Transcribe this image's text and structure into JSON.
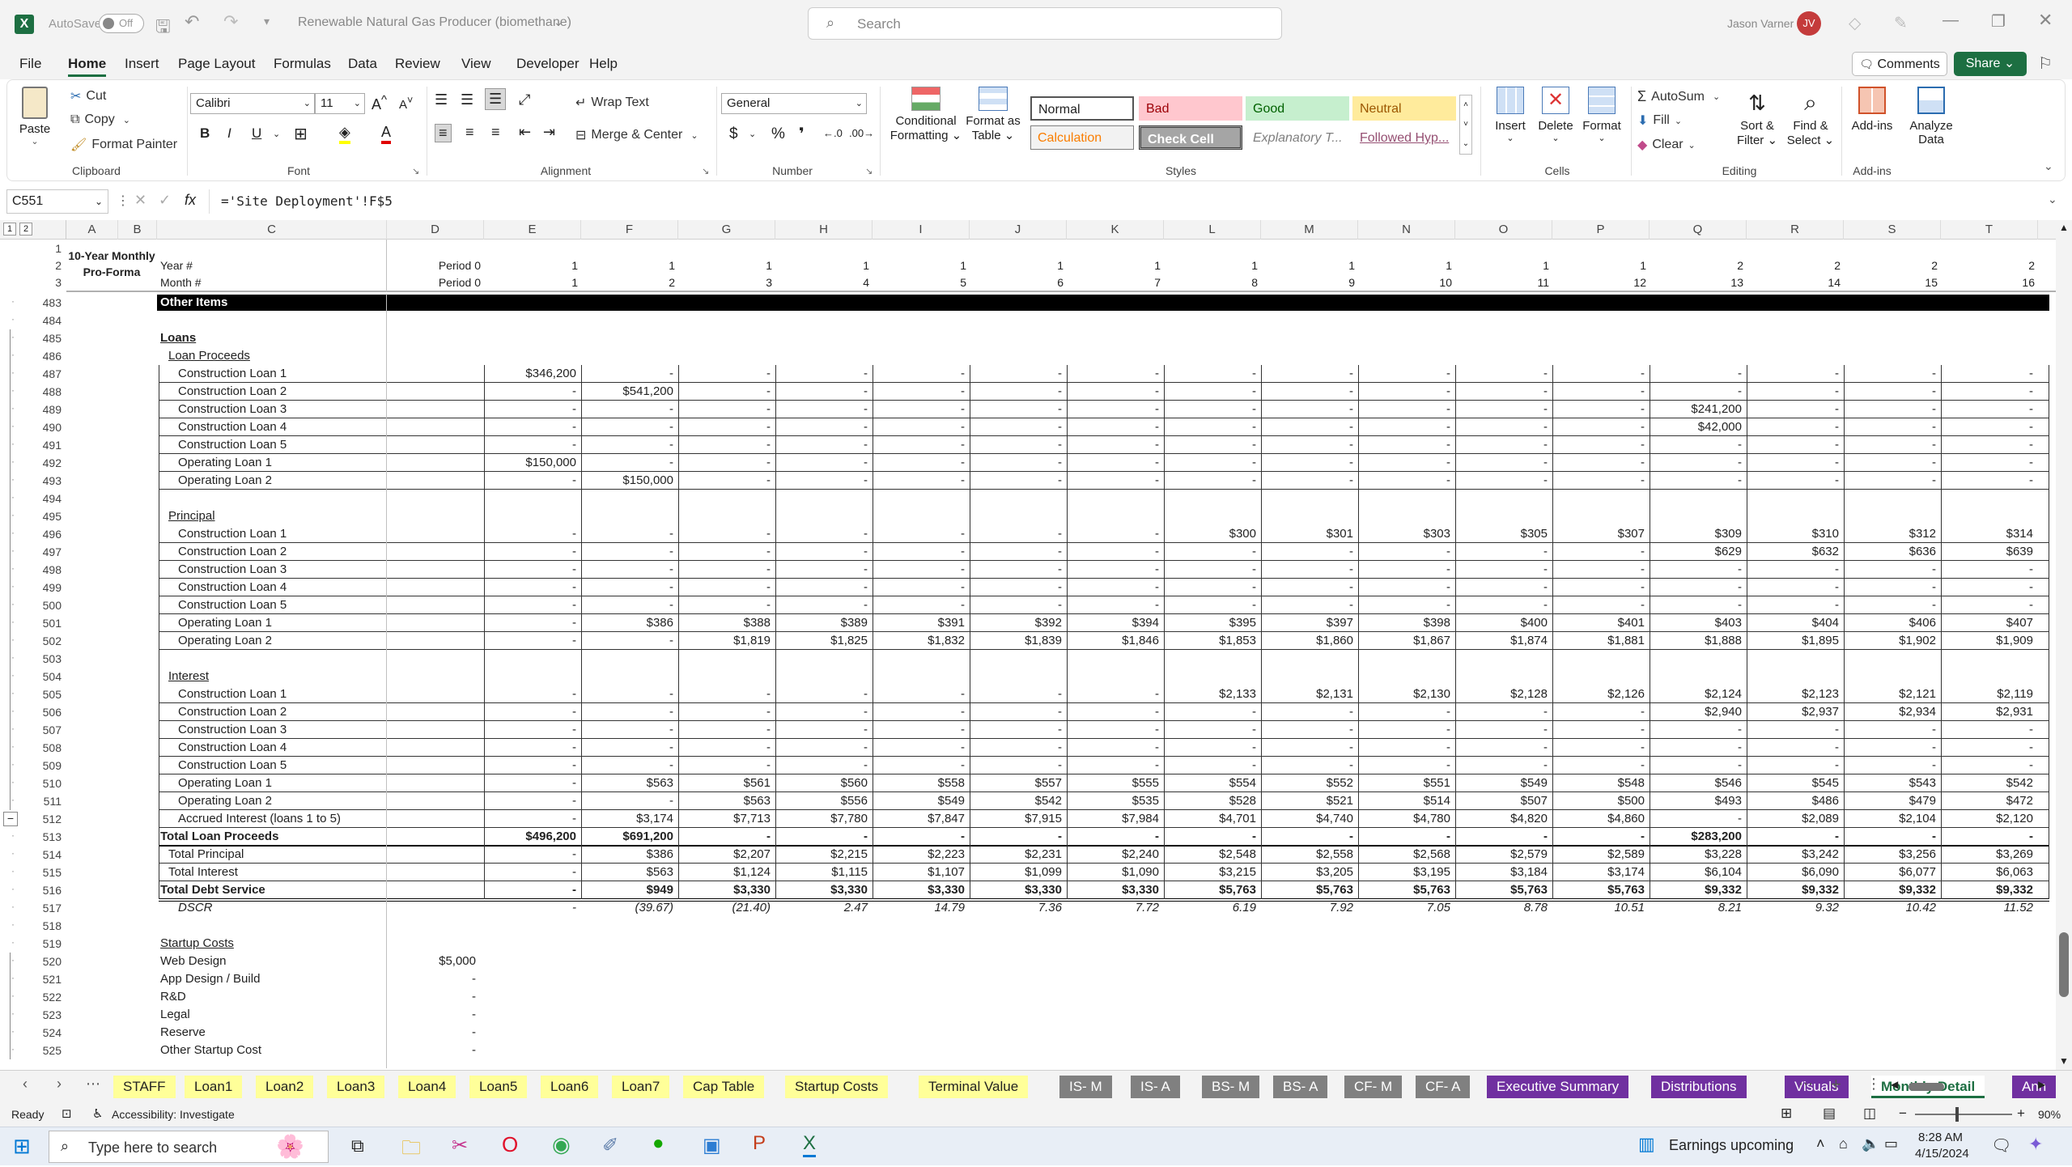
{
  "titlebar": {
    "autosave": "AutoSave",
    "toggle": "Off",
    "title": "Renewable Natural Gas Producer (biomethane)",
    "search_placeholder": "Search",
    "user": "Jason Varner",
    "initials": "JV"
  },
  "menu": [
    "File",
    "Home",
    "Insert",
    "Page Layout",
    "Formulas",
    "Data",
    "Review",
    "View",
    "Developer",
    "Help"
  ],
  "comments_label": "Comments",
  "share_label": "Share",
  "ribbon": {
    "clipboard": {
      "paste": "Paste",
      "cut": "Cut",
      "copy": "Copy",
      "format_painter": "Format Painter",
      "group": "Clipboard"
    },
    "font": {
      "name": "Calibri",
      "size": "11",
      "group": "Font"
    },
    "alignment": {
      "wrap": "Wrap Text",
      "merge": "Merge & Center",
      "group": "Alignment"
    },
    "number": {
      "format": "General",
      "group": "Number"
    },
    "styles": {
      "cond1": "Conditional",
      "cond2": "Formatting",
      "fat1": "Format as",
      "fat2": "Table",
      "normal": "Normal",
      "bad": "Bad",
      "good": "Good",
      "neutral": "Neutral",
      "calculation": "Calculation",
      "check": "Check Cell",
      "explanatory": "Explanatory T...",
      "followed": "Followed Hyp...",
      "group": "Styles"
    },
    "cells": {
      "insert": "Insert",
      "delete": "Delete",
      "format": "Format",
      "group": "Cells"
    },
    "editing": {
      "autosum": "AutoSum",
      "fill": "Fill",
      "clear": "Clear",
      "sort1": "Sort &",
      "sort2": "Filter",
      "find1": "Find &",
      "find2": "Select",
      "group": "Editing"
    },
    "addins": {
      "addins": "Add-ins",
      "analyze1": "Analyze",
      "analyze2": "Data",
      "group": "Add-ins"
    }
  },
  "namebox": "C551",
  "formula": "='Site Deployment'!F$5",
  "outline_levels": [
    "1",
    "2"
  ],
  "columns": [
    "A",
    "B",
    "C",
    "D",
    "E",
    "F",
    "G",
    "H",
    "I",
    "J",
    "K",
    "L",
    "M",
    "N",
    "O",
    "P",
    "Q",
    "R",
    "S",
    "T"
  ],
  "frozen": {
    "r1": "1",
    "r2": "2",
    "r3": "3",
    "title1": "10-Year Monthly",
    "title2": "Pro-Forma",
    "year_label": "Year #",
    "month_label": "Month #",
    "period0": "Period 0",
    "years": [
      "1",
      "1",
      "1",
      "1",
      "1",
      "1",
      "1",
      "1",
      "1",
      "1",
      "1",
      "1",
      "2",
      "2",
      "2",
      "2"
    ],
    "months": [
      "1",
      "2",
      "3",
      "4",
      "5",
      "6",
      "7",
      "8",
      "9",
      "10",
      "11",
      "12",
      "13",
      "14",
      "15",
      "16"
    ]
  },
  "rows": [
    {
      "n": "483",
      "type": "banner",
      "label": "Other Items"
    },
    {
      "n": "484",
      "type": "blank"
    },
    {
      "n": "485",
      "type": "head",
      "label": "Loans"
    },
    {
      "n": "486",
      "type": "sub",
      "label": "Loan Proceeds"
    },
    {
      "n": "487",
      "type": "box",
      "label": "Construction Loan 1",
      "v": [
        "$346,200",
        "-",
        "-",
        "-",
        "-",
        "-",
        "-",
        "-",
        "-",
        "-",
        "-",
        "-",
        "-",
        "-",
        "-",
        "-"
      ]
    },
    {
      "n": "488",
      "type": "box",
      "label": "Construction Loan 2",
      "v": [
        "-",
        "$541,200",
        "-",
        "-",
        "-",
        "-",
        "-",
        "-",
        "-",
        "-",
        "-",
        "-",
        "-",
        "-",
        "-",
        "-"
      ]
    },
    {
      "n": "489",
      "type": "box",
      "label": "Construction Loan 3",
      "v": [
        "-",
        "-",
        "-",
        "-",
        "-",
        "-",
        "-",
        "-",
        "-",
        "-",
        "-",
        "-",
        "$241,200",
        "-",
        "-",
        "-"
      ]
    },
    {
      "n": "490",
      "type": "box",
      "label": "Construction Loan 4",
      "v": [
        "-",
        "-",
        "-",
        "-",
        "-",
        "-",
        "-",
        "-",
        "-",
        "-",
        "-",
        "-",
        "$42,000",
        "-",
        "-",
        "-"
      ]
    },
    {
      "n": "491",
      "type": "box",
      "label": "Construction Loan 5",
      "v": [
        "-",
        "-",
        "-",
        "-",
        "-",
        "-",
        "-",
        "-",
        "-",
        "-",
        "-",
        "-",
        "-",
        "-",
        "-",
        "-"
      ]
    },
    {
      "n": "492",
      "type": "box",
      "label": "Operating Loan 1",
      "v": [
        "$150,000",
        "-",
        "-",
        "-",
        "-",
        "-",
        "-",
        "-",
        "-",
        "-",
        "-",
        "-",
        "-",
        "-",
        "-",
        "-"
      ]
    },
    {
      "n": "493",
      "type": "box",
      "label": "Operating Loan 2",
      "v": [
        "-",
        "$150,000",
        "-",
        "-",
        "-",
        "-",
        "-",
        "-",
        "-",
        "-",
        "-",
        "-",
        "-",
        "-",
        "-",
        "-"
      ]
    },
    {
      "n": "494",
      "type": "blank"
    },
    {
      "n": "495",
      "type": "sub",
      "label": "Principal"
    },
    {
      "n": "496",
      "type": "box",
      "label": "Construction Loan 1",
      "v": [
        "-",
        "-",
        "-",
        "-",
        "-",
        "-",
        "-",
        "$300",
        "$301",
        "$303",
        "$305",
        "$307",
        "$309",
        "$310",
        "$312",
        "$314"
      ]
    },
    {
      "n": "497",
      "type": "box",
      "label": "Construction Loan 2",
      "v": [
        "-",
        "-",
        "-",
        "-",
        "-",
        "-",
        "-",
        "-",
        "-",
        "-",
        "-",
        "-",
        "$629",
        "$632",
        "$636",
        "$639"
      ]
    },
    {
      "n": "498",
      "type": "box",
      "label": "Construction Loan 3",
      "v": [
        "-",
        "-",
        "-",
        "-",
        "-",
        "-",
        "-",
        "-",
        "-",
        "-",
        "-",
        "-",
        "-",
        "-",
        "-",
        "-"
      ]
    },
    {
      "n": "499",
      "type": "box",
      "label": "Construction Loan 4",
      "v": [
        "-",
        "-",
        "-",
        "-",
        "-",
        "-",
        "-",
        "-",
        "-",
        "-",
        "-",
        "-",
        "-",
        "-",
        "-",
        "-"
      ]
    },
    {
      "n": "500",
      "type": "box",
      "label": "Construction Loan 5",
      "v": [
        "-",
        "-",
        "-",
        "-",
        "-",
        "-",
        "-",
        "-",
        "-",
        "-",
        "-",
        "-",
        "-",
        "-",
        "-",
        "-"
      ]
    },
    {
      "n": "501",
      "type": "box",
      "label": "Operating Loan 1",
      "v": [
        "-",
        "$386",
        "$388",
        "$389",
        "$391",
        "$392",
        "$394",
        "$395",
        "$397",
        "$398",
        "$400",
        "$401",
        "$403",
        "$404",
        "$406",
        "$407"
      ]
    },
    {
      "n": "502",
      "type": "box",
      "label": "Operating Loan 2",
      "v": [
        "-",
        "-",
        "$1,819",
        "$1,825",
        "$1,832",
        "$1,839",
        "$1,846",
        "$1,853",
        "$1,860",
        "$1,867",
        "$1,874",
        "$1,881",
        "$1,888",
        "$1,895",
        "$1,902",
        "$1,909"
      ]
    },
    {
      "n": "503",
      "type": "blank"
    },
    {
      "n": "504",
      "type": "sub",
      "label": "Interest"
    },
    {
      "n": "505",
      "type": "box",
      "label": "Construction Loan 1",
      "v": [
        "-",
        "-",
        "-",
        "-",
        "-",
        "-",
        "-",
        "$2,133",
        "$2,131",
        "$2,130",
        "$2,128",
        "$2,126",
        "$2,124",
        "$2,123",
        "$2,121",
        "$2,119"
      ]
    },
    {
      "n": "506",
      "type": "box",
      "label": "Construction Loan 2",
      "v": [
        "-",
        "-",
        "-",
        "-",
        "-",
        "-",
        "-",
        "-",
        "-",
        "-",
        "-",
        "-",
        "$2,940",
        "$2,937",
        "$2,934",
        "$2,931"
      ]
    },
    {
      "n": "507",
      "type": "box",
      "label": "Construction Loan 3",
      "v": [
        "-",
        "-",
        "-",
        "-",
        "-",
        "-",
        "-",
        "-",
        "-",
        "-",
        "-",
        "-",
        "-",
        "-",
        "-",
        "-"
      ]
    },
    {
      "n": "508",
      "type": "box",
      "label": "Construction Loan 4",
      "v": [
        "-",
        "-",
        "-",
        "-",
        "-",
        "-",
        "-",
        "-",
        "-",
        "-",
        "-",
        "-",
        "-",
        "-",
        "-",
        "-"
      ]
    },
    {
      "n": "509",
      "type": "box",
      "label": "Construction Loan 5",
      "v": [
        "-",
        "-",
        "-",
        "-",
        "-",
        "-",
        "-",
        "-",
        "-",
        "-",
        "-",
        "-",
        "-",
        "-",
        "-",
        "-"
      ]
    },
    {
      "n": "510",
      "type": "box",
      "label": "Operating Loan 1",
      "v": [
        "-",
        "$563",
        "$561",
        "$560",
        "$558",
        "$557",
        "$555",
        "$554",
        "$552",
        "$551",
        "$549",
        "$548",
        "$546",
        "$545",
        "$543",
        "$542"
      ]
    },
    {
      "n": "511",
      "type": "box",
      "label": "Operating Loan 2",
      "v": [
        "-",
        "-",
        "$563",
        "$556",
        "$549",
        "$542",
        "$535",
        "$528",
        "$521",
        "$514",
        "$507",
        "$500",
        "$493",
        "$486",
        "$479",
        "$472"
      ]
    },
    {
      "n": "512",
      "type": "box",
      "label": "Accrued Interest (loans 1 to 5)",
      "v": [
        "-",
        "$3,174",
        "$7,713",
        "$7,780",
        "$7,847",
        "$7,915",
        "$7,984",
        "$4,701",
        "$4,740",
        "$4,780",
        "$4,820",
        "$4,860",
        "-",
        "$2,089",
        "$2,104",
        "$2,120"
      ]
    },
    {
      "n": "513",
      "type": "total",
      "label": "Total Loan Proceeds",
      "v": [
        "$496,200",
        "$691,200",
        "-",
        "-",
        "-",
        "-",
        "-",
        "-",
        "-",
        "-",
        "-",
        "-",
        "$283,200",
        "-",
        "-",
        "-"
      ]
    },
    {
      "n": "514",
      "type": "subtotal",
      "label": "Total Principal",
      "v": [
        "-",
        "$386",
        "$2,207",
        "$2,215",
        "$2,223",
        "$2,231",
        "$2,240",
        "$2,548",
        "$2,558",
        "$2,568",
        "$2,579",
        "$2,589",
        "$3,228",
        "$3,242",
        "$3,256",
        "$3,269"
      ]
    },
    {
      "n": "515",
      "type": "subtotal",
      "label": "Total Interest",
      "v": [
        "-",
        "$563",
        "$1,124",
        "$1,115",
        "$1,107",
        "$1,099",
        "$1,090",
        "$3,215",
        "$3,205",
        "$3,195",
        "$3,184",
        "$3,174",
        "$6,104",
        "$6,090",
        "$6,077",
        "$6,063"
      ]
    },
    {
      "n": "516",
      "type": "total2",
      "label": "Total Debt Service",
      "v": [
        "-",
        "$949",
        "$3,330",
        "$3,330",
        "$3,330",
        "$3,330",
        "$3,330",
        "$5,763",
        "$5,763",
        "$5,763",
        "$5,763",
        "$5,763",
        "$9,332",
        "$9,332",
        "$9,332",
        "$9,332"
      ]
    },
    {
      "n": "517",
      "type": "dscr",
      "label": "DSCR",
      "v": [
        "-",
        "(39.67)",
        "(21.40)",
        "2.47",
        "14.79",
        "7.36",
        "7.72",
        "6.19",
        "7.92",
        "7.05",
        "8.78",
        "10.51",
        "8.21",
        "9.32",
        "10.42",
        "11.52"
      ]
    },
    {
      "n": "518",
      "type": "blank"
    },
    {
      "n": "519",
      "type": "head2",
      "label": "Startup Costs"
    },
    {
      "n": "520",
      "type": "plain",
      "label": "Web Design",
      "d": "$5,000"
    },
    {
      "n": "521",
      "type": "plain",
      "label": "App Design / Build",
      "d": "-"
    },
    {
      "n": "522",
      "type": "plain",
      "label": "R&D",
      "d": "-"
    },
    {
      "n": "523",
      "type": "plain",
      "label": "Legal",
      "d": "-"
    },
    {
      "n": "524",
      "type": "plain",
      "label": "Reserve",
      "d": "-"
    },
    {
      "n": "525",
      "type": "plain",
      "label": "Other Startup Cost",
      "d": "-"
    }
  ],
  "tabs": [
    {
      "label": "STAFF",
      "bg": "#ffff99",
      "fg": "#222"
    },
    {
      "label": "Loan1",
      "bg": "#ffff99",
      "fg": "#222"
    },
    {
      "label": "Loan2",
      "bg": "#ffff99",
      "fg": "#222"
    },
    {
      "label": "Loan3",
      "bg": "#ffff99",
      "fg": "#222"
    },
    {
      "label": "Loan4",
      "bg": "#ffff99",
      "fg": "#222"
    },
    {
      "label": "Loan5",
      "bg": "#ffff99",
      "fg": "#222"
    },
    {
      "label": "Loan6",
      "bg": "#ffff99",
      "fg": "#222"
    },
    {
      "label": "Loan7",
      "bg": "#ffff99",
      "fg": "#222"
    },
    {
      "label": "Cap Table",
      "bg": "#ffff99",
      "fg": "#222"
    },
    {
      "label": "Startup Costs",
      "bg": "#ffff99",
      "fg": "#222"
    },
    {
      "label": "Terminal Value",
      "bg": "#ffff99",
      "fg": "#222"
    },
    {
      "label": "IS- M",
      "bg": "#808080",
      "fg": "#fff"
    },
    {
      "label": "IS- A",
      "bg": "#808080",
      "fg": "#fff"
    },
    {
      "label": "BS- M",
      "bg": "#808080",
      "fg": "#fff"
    },
    {
      "label": "BS- A",
      "bg": "#808080",
      "fg": "#fff"
    },
    {
      "label": "CF- M",
      "bg": "#808080",
      "fg": "#fff"
    },
    {
      "label": "CF- A",
      "bg": "#808080",
      "fg": "#fff"
    },
    {
      "label": "Executive Summary",
      "bg": "#7030a0",
      "fg": "#fff"
    },
    {
      "label": "Distributions",
      "bg": "#7030a0",
      "fg": "#fff"
    },
    {
      "label": "Visuals",
      "bg": "#7030a0",
      "fg": "#fff"
    },
    {
      "label": "Monthly Detail",
      "bg": "#ffffff",
      "fg": "#222",
      "active": true
    },
    {
      "label": "Ann",
      "bg": "#7030a0",
      "fg": "#fff"
    }
  ],
  "status": {
    "ready": "Ready",
    "accessibility": "Accessibility: Investigate",
    "zoom": "90%"
  },
  "taskbar": {
    "search_placeholder": "Type here to search",
    "weather": "Earnings upcoming",
    "time": "8:28 AM",
    "date": "4/15/2024"
  }
}
